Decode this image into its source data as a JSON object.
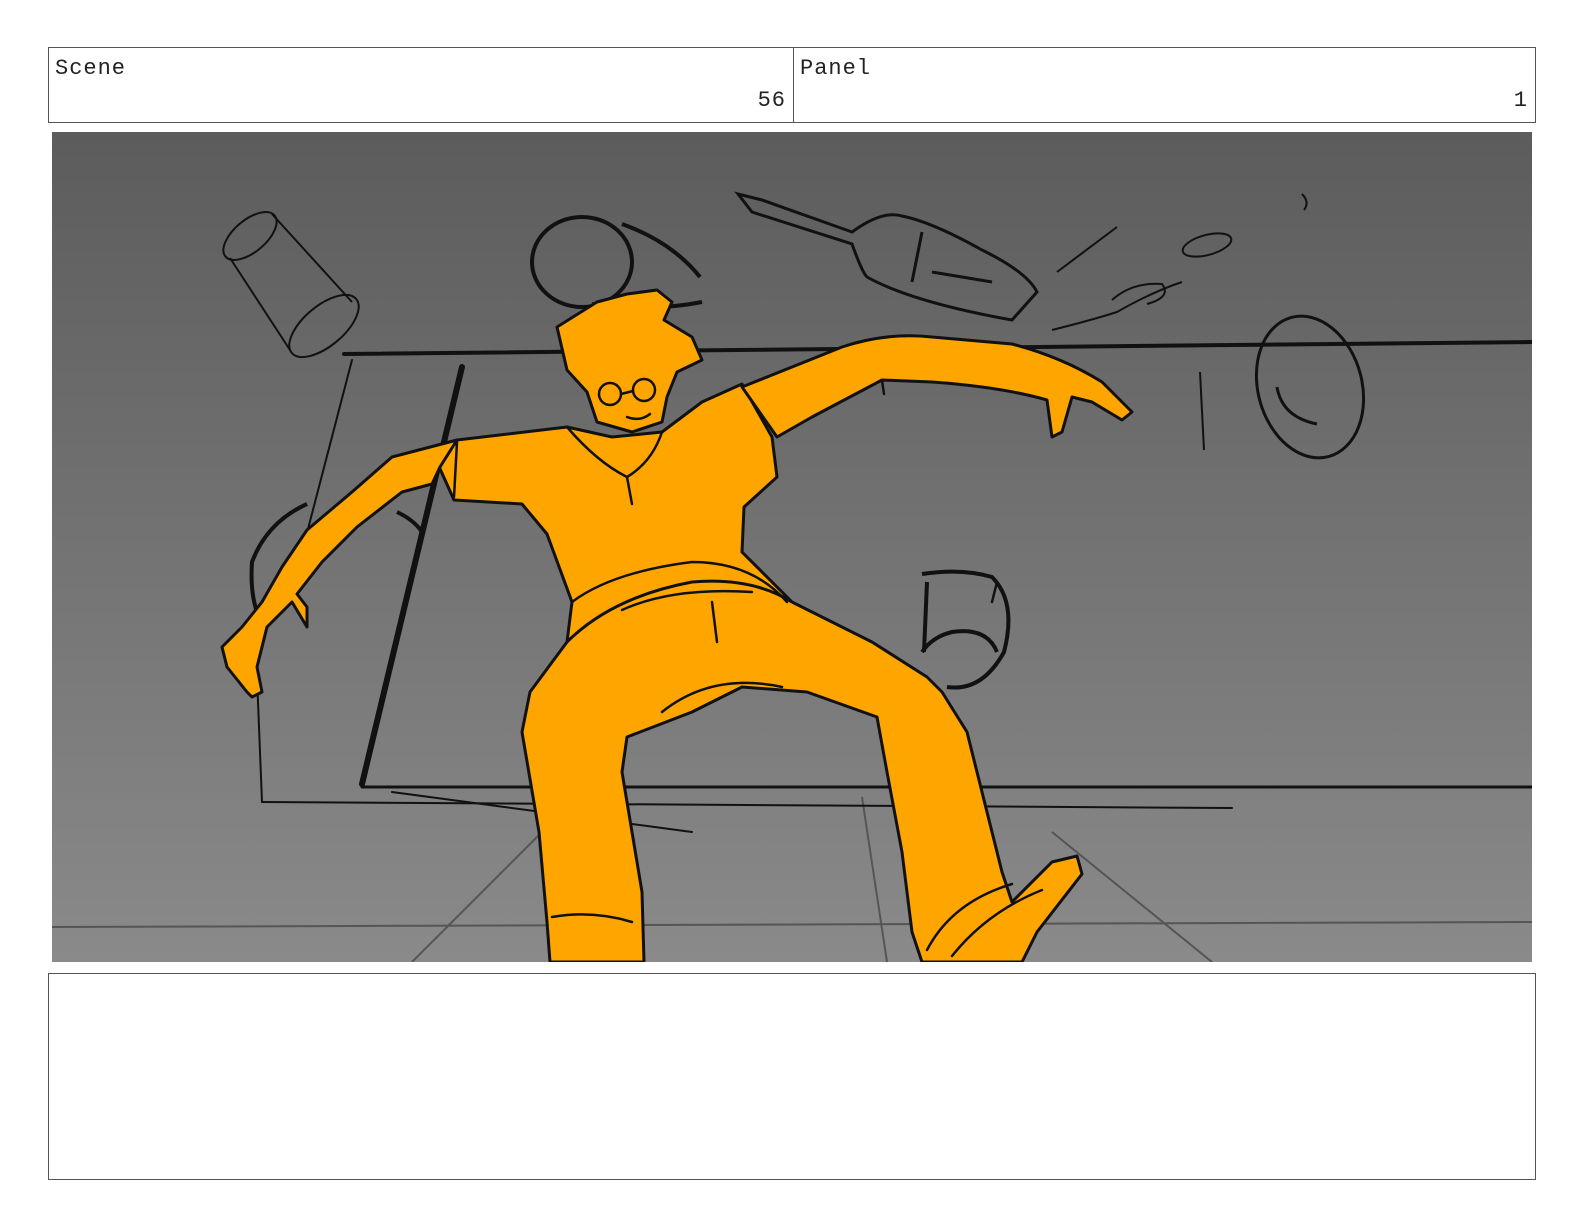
{
  "header": {
    "scene_label": "Scene",
    "scene_number": "56",
    "panel_label": "Panel",
    "panel_number": "1"
  },
  "frame": {
    "background_top": "#5c5c5c",
    "background_bottom": "#8a8a8a",
    "figure_fill": "#ffa500",
    "ink": "#111111"
  },
  "notes": {
    "text": ""
  }
}
